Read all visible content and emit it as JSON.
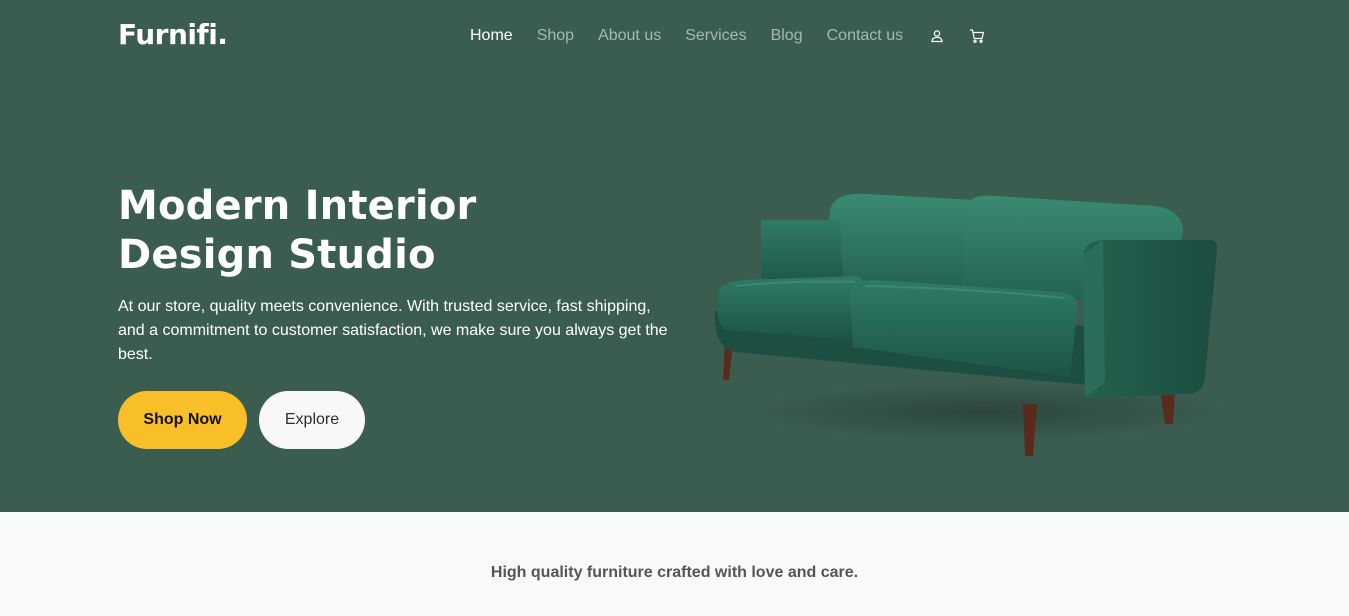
{
  "brand": {
    "logo": "Furnifi."
  },
  "nav": {
    "items": [
      {
        "label": "Home",
        "active": true
      },
      {
        "label": "Shop"
      },
      {
        "label": "About us"
      },
      {
        "label": "Services"
      },
      {
        "label": "Blog"
      },
      {
        "label": "Contact us"
      }
    ],
    "icons": [
      "user-icon",
      "cart-icon"
    ]
  },
  "hero": {
    "title_line1": "Modern Interior",
    "title_line2": "Design Studio",
    "description": "At our store, quality meets convenience. With trusted service, fast shipping, and a commitment to customer satisfaction, we make sure you always get the best.",
    "primary_button": "Shop Now",
    "secondary_button": "Explore",
    "image": "green-velvet-sofa"
  },
  "tagline": "High quality furniture crafted with love and care.",
  "colors": {
    "hero_bg": "#3b5d50",
    "accent": "#f9bf29",
    "page_bg": "#f8f9fa"
  }
}
